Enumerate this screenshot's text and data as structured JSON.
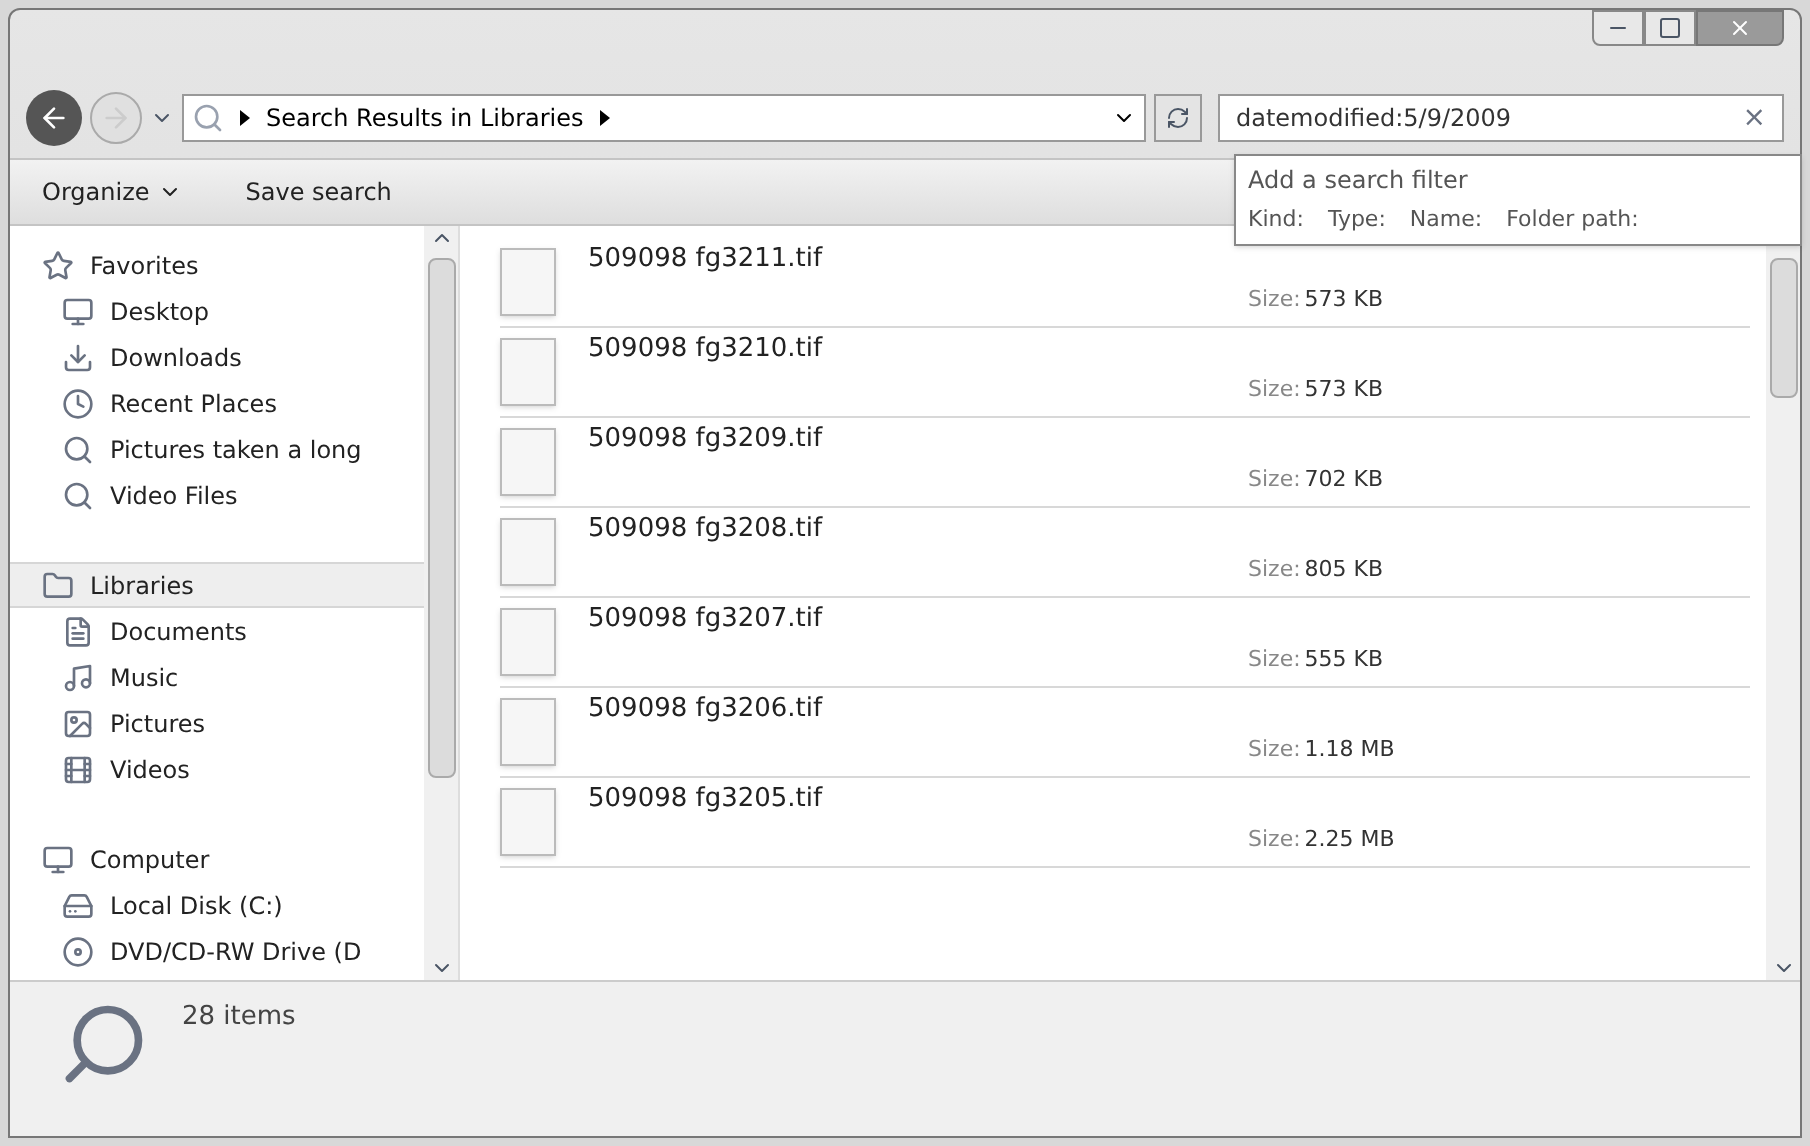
{
  "address_bar": {
    "crumbs": [
      "Search Results in Libraries"
    ]
  },
  "search": {
    "value": "datemodified:5/9/2009",
    "clear": "×"
  },
  "search_filter": {
    "title": "Add a search filter",
    "filters": [
      "Kind:",
      "Type:",
      "Name:",
      "Folder path:"
    ]
  },
  "toolbar": {
    "buttons": [
      {
        "label": "Organize",
        "dropdown": true
      },
      {
        "label": "Save search",
        "dropdown": false
      }
    ]
  },
  "sidebar": {
    "groups": [
      {
        "label": "Favorites",
        "kind": "star",
        "selected": false,
        "children": [
          {
            "label": "Desktop",
            "kind": "desktop"
          },
          {
            "label": "Downloads",
            "kind": "download"
          },
          {
            "label": "Recent Places",
            "kind": "recent"
          },
          {
            "label": "Pictures taken a long",
            "kind": "search"
          },
          {
            "label": "Video Files",
            "kind": "search"
          }
        ]
      },
      {
        "label": "Libraries",
        "kind": "library",
        "selected": true,
        "children": [
          {
            "label": "Documents",
            "kind": "document"
          },
          {
            "label": "Music",
            "kind": "music"
          },
          {
            "label": "Pictures",
            "kind": "picture"
          },
          {
            "label": "Videos",
            "kind": "video"
          }
        ]
      },
      {
        "label": "Computer",
        "kind": "computer",
        "selected": false,
        "children": [
          {
            "label": "Local Disk (C:)",
            "kind": "disk"
          },
          {
            "label": "DVD/CD-RW Drive (D",
            "kind": "dvd"
          }
        ]
      }
    ]
  },
  "files": [
    {
      "name": "509098 fg3211.tif",
      "size_label": "Size:",
      "size": "573 KB"
    },
    {
      "name": "509098 fg3210.tif",
      "size_label": "Size:",
      "size": "573 KB"
    },
    {
      "name": "509098 fg3209.tif",
      "size_label": "Size:",
      "size": "702 KB"
    },
    {
      "name": "509098 fg3208.tif",
      "size_label": "Size:",
      "size": "805 KB"
    },
    {
      "name": "509098 fg3207.tif",
      "size_label": "Size:",
      "size": "555 KB"
    },
    {
      "name": "509098 fg3206.tif",
      "size_label": "Size:",
      "size": "1.18 MB"
    },
    {
      "name": "509098 fg3205.tif",
      "size_label": "Size:",
      "size": "2.25 MB"
    }
  ],
  "status_bar": {
    "count": "28 items"
  }
}
